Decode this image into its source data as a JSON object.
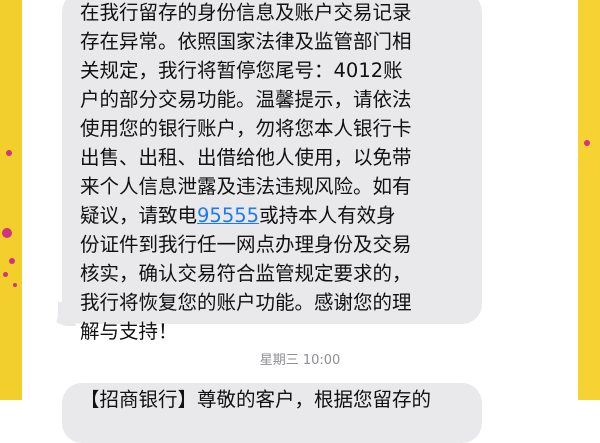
{
  "message": {
    "lines": [
      "在我行留存的身份信息及账户交易记录",
      "存在异常。依照国家法律及监管部门相",
      "关规定，我行将暂停您尾号：4012账",
      "户的部分交易功能。温馨提示，请依法",
      "使用您的银行账户，勿将您本人银行卡",
      "出售、出租、出借给他人使用，以免带",
      "来个人信息泄露及违法违规风险。如有"
    ],
    "line8_before": "疑议，请致电",
    "phone": "95555",
    "line8_after": "或持本人有效身",
    "lines_after": [
      "份证件到我行任一网点办理身份及交易",
      "核实，确认交易符合监管规定要求的，",
      "我行将恢复您的账户功能。感谢您的理",
      "解与支持！"
    ]
  },
  "timestamp": "星期三 10:00",
  "next_message": {
    "partial_text": "【招商银行】尊敬的客户，根据您留存的"
  },
  "colors": {
    "bubble": "#e9e9eb",
    "link": "#1e7af0",
    "side_left": "#f3cf2c",
    "side_right": "#f7d233",
    "confetti": "#d4327e"
  }
}
